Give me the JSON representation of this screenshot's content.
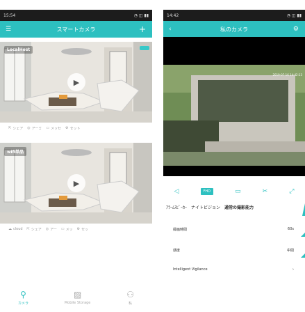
{
  "left": {
    "status": {
      "time": "15:54",
      "carrier": "",
      "icons": "◔ ◫ ▮▮"
    },
    "title": "スマートカメラ",
    "menu_icon": "menu-icon",
    "add_label": "+",
    "cameras": [
      {
        "name": "LocalHost",
        "actions": [
          "シェア",
          "アーミ",
          "メッセ",
          "セット"
        ]
      },
      {
        "name": "wifi単品",
        "actions": [
          "cloud",
          "シェア",
          "アー",
          "メッ",
          "セッ"
        ]
      }
    ],
    "nav": [
      {
        "label": "カメラ",
        "icon": "camera-icon",
        "active": true
      },
      {
        "label": "Mobile Storage",
        "icon": "gallery-icon",
        "active": false
      },
      {
        "label": "私",
        "icon": "person-icon",
        "active": false
      }
    ]
  },
  "right": {
    "status": {
      "time": "14:42"
    },
    "title": "私のカメラ",
    "video_timestamp": "2019-07-16 14:42:13",
    "hd_label": "FHD",
    "features": [
      "ｱﾗｰﾑｽﾋﾟｰｶｰ",
      "ナイトビジョン",
      "通常の撮影能力"
    ],
    "settings": [
      {
        "label": "録画時間",
        "value": "60s"
      },
      {
        "label": "感度",
        "value": "中間"
      },
      {
        "label": "Intelligent Vigilance",
        "value": ""
      }
    ]
  },
  "colors": {
    "accent": "#2dc0c0",
    "statusbar": "#1c1c1c"
  }
}
